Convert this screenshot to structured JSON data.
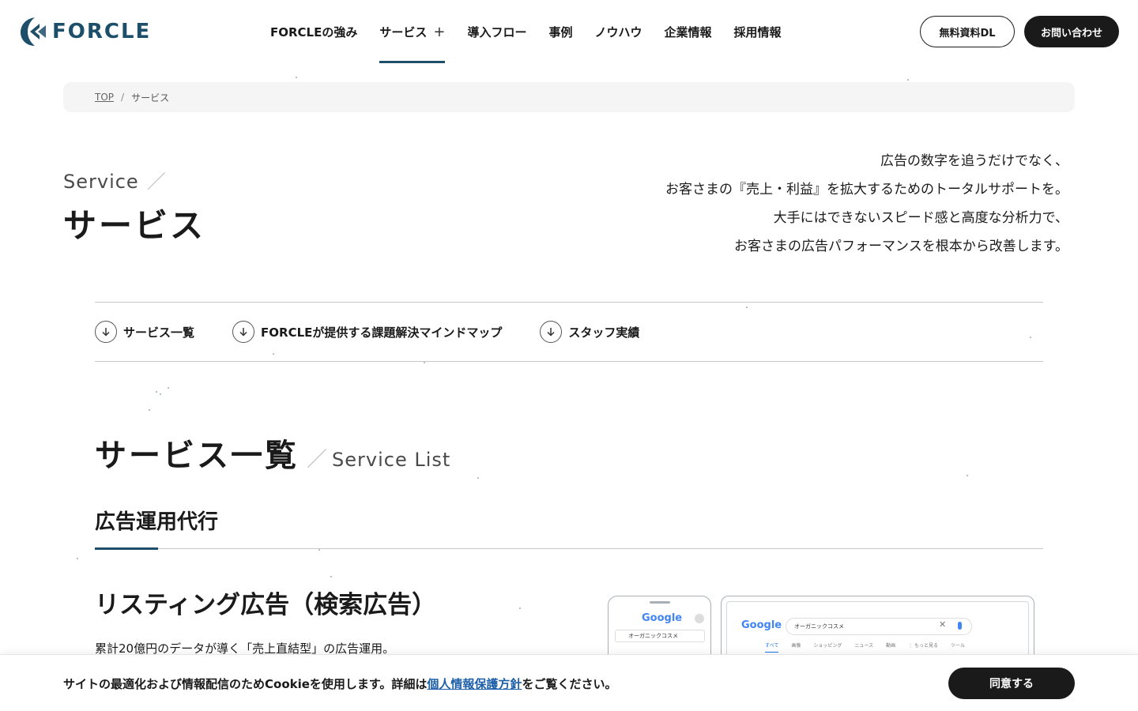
{
  "header": {
    "logo_text": "FORCLE",
    "nav": [
      {
        "label": "FORCLEの強み"
      },
      {
        "label": "サービス",
        "plus": "+"
      },
      {
        "label": "導入フロー"
      },
      {
        "label": "事例"
      },
      {
        "label": "ノウハウ"
      },
      {
        "label": "企業情報"
      },
      {
        "label": "採用情報"
      }
    ],
    "download_label": "無料資料DL",
    "contact_label": "お問い合わせ"
  },
  "breadcrumb": {
    "home": "TOP",
    "separator": "/",
    "current": "サービス"
  },
  "hero": {
    "title_en": "Service",
    "title_slash": "／",
    "title_ja": "サービス",
    "copy": [
      "広告の数字を追うだけでなく、",
      "お客さまの『売上・利益』を拡大するためのトータルサポートを。",
      "大手にはできないスピード感と高度な分析力で、",
      "お客さまの広告パフォーマンスを根本から改善します。"
    ]
  },
  "anchors": [
    {
      "label": "サービス一覧"
    },
    {
      "label": "FORCLEが提供する課題解決マインドマップ"
    },
    {
      "label": "スタッフ実績"
    }
  ],
  "service_list": {
    "title_ja": "サービス一覧",
    "title_slash": "／",
    "title_en": "Service List",
    "category": "広告運用代行",
    "service_title": "リスティング広告（検索広告）",
    "service_desc": "累計20億円のデータが導く「売上直結型」の広告運用。"
  },
  "mockup": {
    "phone_brand": "Google",
    "phone_query": "オーガニックコスメ",
    "laptop_brand": "Google",
    "laptop_query": "オーガニックコスメ",
    "laptop_tabs": [
      "すべて",
      "画像",
      "ショッピング",
      "ニュース",
      "動画",
      "⋮ もっと見る",
      "ツール"
    ]
  },
  "cookie": {
    "text_before": "サイトの最適化および情報配信のためCookieを使用します。詳細は",
    "link": "個人情報保護方針",
    "text_after": "をご覧ください。",
    "accept_label": "同意する"
  },
  "colors": {
    "brand": "#1d4f6b",
    "dark": "#1a1a1a",
    "link": "#1d5fa8"
  }
}
